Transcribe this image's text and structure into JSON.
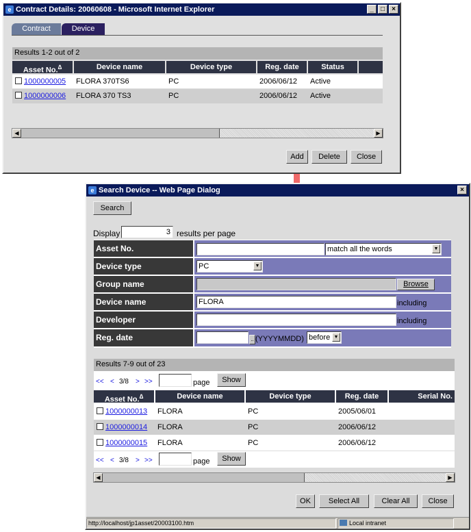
{
  "contract_window": {
    "title": "Contract Details: 20060608 - Microsoft Internet Explorer",
    "tabs": [
      {
        "label": "Contract"
      },
      {
        "label": "Device"
      }
    ],
    "results_text": "Results 1-2 out of 2",
    "columns": [
      "Asset No.",
      "Device name",
      "Device type",
      "Reg. date",
      "Status"
    ],
    "sort_indicator": "∆",
    "rows": [
      {
        "asset": "1000000005",
        "name": "FLORA 370TS6",
        "type": "PC",
        "date": "2006/06/12",
        "status": "Active"
      },
      {
        "asset": "1000000006",
        "name": "FLORA 370 TS3",
        "type": "PC",
        "date": "2006/06/12",
        "status": "Active"
      }
    ],
    "buttons": {
      "add": "Add",
      "delete": "Delete",
      "close": "Close"
    }
  },
  "arrow_color": "#f06a6a",
  "search_dialog": {
    "title": "Search Device -- Web Page Dialog",
    "search_button": "Search",
    "display_label": "Display",
    "display_value": "3",
    "display_suffix": "results per page",
    "form": {
      "asset_no": {
        "label": "Asset No.",
        "value": "",
        "match": "match all the words"
      },
      "device_type": {
        "label": "Device type",
        "value": "PC"
      },
      "group_name": {
        "label": "Group name",
        "value": "",
        "browse": "Browse"
      },
      "device_name": {
        "label": "Device name",
        "value": "FLORA",
        "suffix": "including"
      },
      "developer": {
        "label": "Developer",
        "value": "",
        "suffix": "including"
      },
      "reg_date": {
        "label": "Reg. date",
        "value": "",
        "picker": "..",
        "format": "(YYYYMMDD)",
        "condition": "before"
      }
    },
    "results_text": "Results 7-9 out of 23",
    "pager": {
      "first": "<<",
      "prev": "<",
      "current": "3/8",
      "next": ">",
      "last": ">>",
      "page_label": "page",
      "show": "Show"
    },
    "columns": [
      "Asset No.",
      "Device name",
      "Device type",
      "Reg. date",
      "Serial No."
    ],
    "rows": [
      {
        "asset": "1000000013",
        "name": "FLORA",
        "type": "PC",
        "date": "2005/06/01",
        "serial": ""
      },
      {
        "asset": "1000000014",
        "name": "FLORA",
        "type": "PC",
        "date": "2006/06/12",
        "serial": ""
      },
      {
        "asset": "1000000015",
        "name": "FLORA",
        "type": "PC",
        "date": "2006/06/12",
        "serial": ""
      }
    ],
    "buttons": {
      "ok": "OK",
      "select_all": "Select All",
      "clear_all": "Clear All",
      "close": "Close"
    },
    "status_url": "http://localhost/jp1asset/20003100.htm",
    "status_zone": "Local intranet"
  }
}
